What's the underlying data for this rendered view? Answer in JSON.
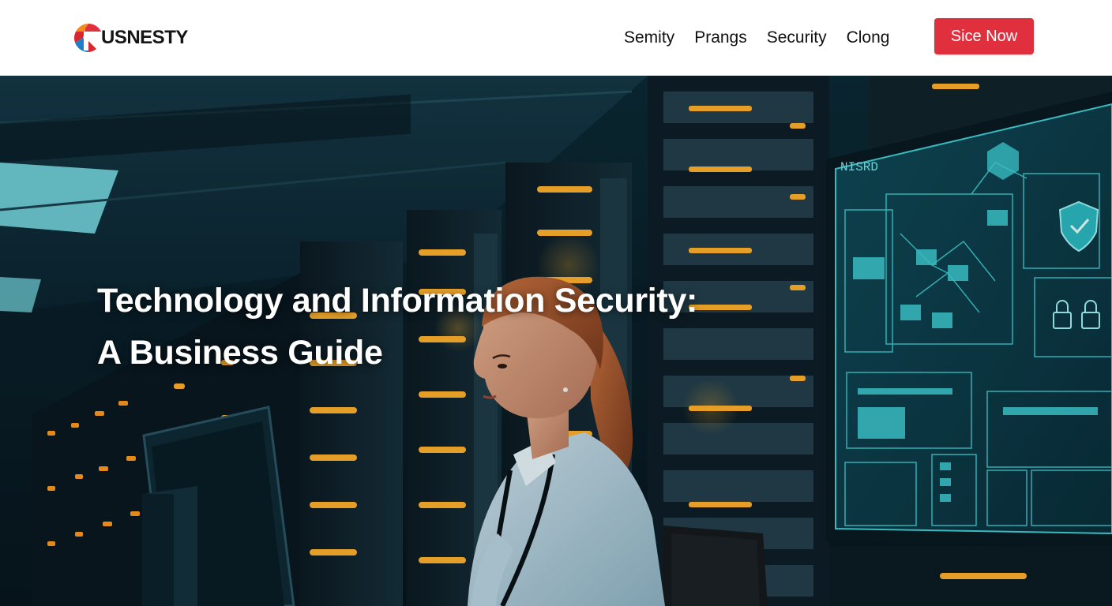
{
  "header": {
    "brand_name": "USNESTY",
    "nav": [
      {
        "label": "Semity"
      },
      {
        "label": "Prangs"
      },
      {
        "label": "Security"
      },
      {
        "label": "Clong"
      }
    ],
    "cta_label": "Sice Now"
  },
  "hero": {
    "title_line1": "Technology and Information Security:",
    "title_line2": "A Business Guide",
    "screen_label": "NISRD",
    "image_description_icons": [
      "server-rack",
      "data-screen",
      "shield-icon",
      "lock-icon",
      "computer-monitor",
      "person-at-workstation"
    ]
  },
  "colors": {
    "accent": "#e0303d",
    "logo_orange": "#f28a1c",
    "logo_red": "#d9272e",
    "logo_blue": "#1f7fc4",
    "rack_led": "#ffb12e",
    "screen_cyan": "#3fd0d6",
    "hero_bg": "#0a1f29"
  }
}
